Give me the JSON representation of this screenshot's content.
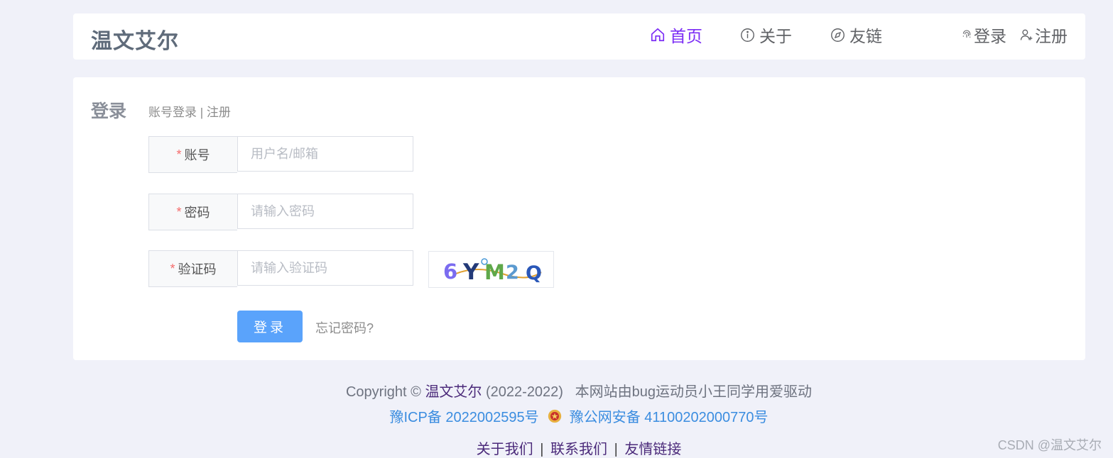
{
  "header": {
    "logo": "温文艾尔",
    "nav": [
      {
        "label": "首页",
        "icon": "home-icon",
        "active": true
      },
      {
        "label": "关于",
        "icon": "info-icon",
        "active": false
      },
      {
        "label": "友链",
        "icon": "compass-icon",
        "active": false
      }
    ],
    "auth": {
      "login": "登录",
      "register": "注册"
    }
  },
  "form": {
    "title": "登录",
    "subtitle_login": "账号登录",
    "subtitle_sep": "|",
    "subtitle_register": "注册",
    "account": {
      "label": "账号",
      "placeholder": "用户名/邮箱",
      "value": ""
    },
    "password": {
      "label": "密码",
      "placeholder": "请输入密码",
      "value": ""
    },
    "captcha": {
      "label": "验证码",
      "placeholder": "请输入验证码",
      "value": "",
      "image_text": "6YM2Q"
    },
    "required_mark": "*",
    "submit": "登录",
    "forgot": "忘记密码?"
  },
  "footer": {
    "copyright_prefix": "Copyright ©",
    "brand": "温文艾尔",
    "years": "(2022-2022)",
    "powered": "本网站由bug运动员小王同学用爱驱动",
    "icp": "豫ICP备 2022002595号",
    "police": "豫公网安备 41100202000770号",
    "links": [
      "关于我们",
      "联系我们",
      "友情链接"
    ],
    "link_sep": "|"
  },
  "watermark": "CSDN @温文艾尔",
  "colors": {
    "background": "#f0f1f9",
    "accent_active": "#7b2cf5",
    "button": "#5aa3fb",
    "link_blue": "#3b8de0",
    "required": "#f56c6c"
  }
}
